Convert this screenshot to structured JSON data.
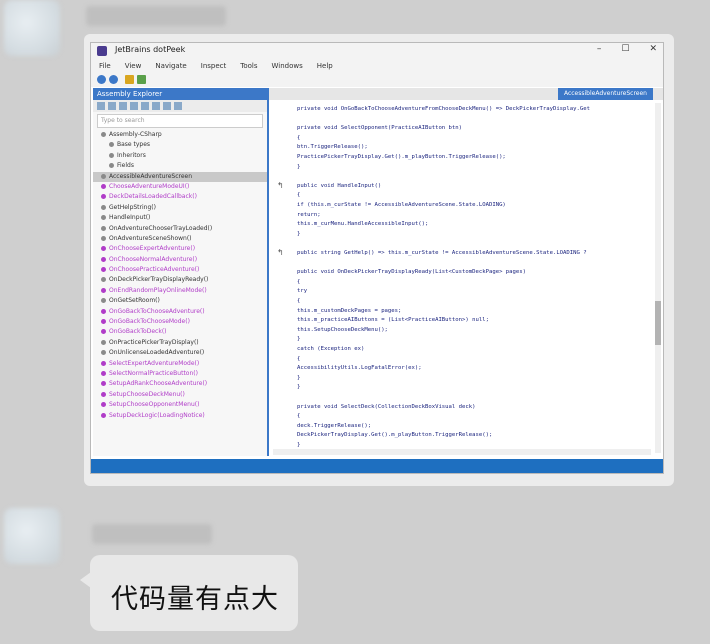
{
  "messages": [
    {
      "type": "image",
      "screenshot": {
        "window_title": "JetBrains dotPeek",
        "menu": [
          "File",
          "View",
          "Navigate",
          "Inspect",
          "Tools",
          "Windows",
          "Help"
        ],
        "explorer_title": "Assembly Explorer",
        "search_placeholder": "Type to search",
        "tree_items": [
          {
            "label": "Assembly-CSharp",
            "color": "#333333"
          },
          {
            "label": "Base types",
            "color": "#333333"
          },
          {
            "label": "Inheritors",
            "color": "#333333"
          },
          {
            "label": "Fields",
            "color": "#333333"
          },
          {
            "label": "AccessibleAdventureScreen",
            "color": "#333333",
            "selected": true
          },
          {
            "label": "ChooseAdventureModeUI()",
            "color": "#b03cc8"
          },
          {
            "label": "DeckDetailsLoadedCallback()",
            "color": "#b03cc8"
          },
          {
            "label": "GetHelpString()",
            "color": "#333333"
          },
          {
            "label": "HandleInput()",
            "color": "#333333"
          },
          {
            "label": "OnAdventureChooserTrayLoaded()",
            "color": "#333333"
          },
          {
            "label": "OnAdventureSceneShown()",
            "color": "#333333"
          },
          {
            "label": "OnChooseExpertAdventure()",
            "color": "#b03cc8"
          },
          {
            "label": "OnChooseNormalAdventure()",
            "color": "#b03cc8"
          },
          {
            "label": "OnChoosePracticeAdventure()",
            "color": "#b03cc8"
          },
          {
            "label": "OnDeckPickerTrayDisplayReady()",
            "color": "#333333"
          },
          {
            "label": "OnEndRandomPlayOnlineMode()",
            "color": "#b03cc8"
          },
          {
            "label": "OnGetSetRoom()",
            "color": "#333333"
          },
          {
            "label": "OnGoBackToChooseAdventure()",
            "color": "#b03cc8"
          },
          {
            "label": "OnGoBackToChooseMode()",
            "color": "#b03cc8"
          },
          {
            "label": "OnGoBackToDeck()",
            "color": "#b03cc8"
          },
          {
            "label": "OnPracticePickerTrayDisplay()",
            "color": "#333333"
          },
          {
            "label": "OnUnlicenseLoadedAdventure()",
            "color": "#333333"
          },
          {
            "label": "SelectExpertAdventureMode()",
            "color": "#b03cc8"
          },
          {
            "label": "SelectNormalPracticeButton()",
            "color": "#b03cc8"
          },
          {
            "label": "SetupAdRankChooseAdventure()",
            "color": "#b03cc8"
          },
          {
            "label": "SetupChooseDeckMenu()",
            "color": "#b03cc8"
          },
          {
            "label": "SetupChooseOpponentMenu()",
            "color": "#b03cc8"
          },
          {
            "label": "SetupDeckLogic(LoadingNotice)",
            "color": "#b03cc8"
          }
        ],
        "editor_tab": "AccessibleAdventureScreen",
        "code_lines": [
          "private void OnGoBackToChooseAdventureFromChooseDeckMenu() => DeckPickerTrayDisplay.Get",
          "",
          "private void SelectOpponent(PracticeAIButton btn)",
          "{",
          "  btn.TriggerRelease();",
          "  PracticePickerTrayDisplay.Get().m_playButton.TriggerRelease();",
          "}",
          "",
          "public void HandleInput()",
          "{",
          "  if (this.m_curState != AccessibleAdventureScene.State.LOADING)",
          "    return;",
          "  this.m_curMenu.HandleAccessibleInput();",
          "}",
          "",
          "public string GetHelp() => this.m_curState != AccessibleAdventureScene.State.LOADING ?",
          "",
          "public void OnDeckPickerTrayDisplayReady(List<CustomDeckPage> pages)",
          "{",
          "  try",
          "  {",
          "    this.m_customDeckPages = pages;",
          "    this.m_practiceAIButtons = (List<PracticeAIButton>) null;",
          "    this.SetupChooseDeckMenu();",
          "  }",
          "  catch (Exception ex)",
          "  {",
          "    AccessibilityUtils.LogFatalError(ex);",
          "  }",
          "}",
          "",
          "private void SelectDeck(CollectionDeckBoxVisual deck)",
          "{",
          "  deck.TriggerRelease();",
          "  DeckPickerTrayDisplay.Get().m_playButton.TriggerRelease();",
          "}"
        ]
      }
    },
    {
      "type": "text",
      "text": "代码量有点大"
    }
  ],
  "colors": {
    "accent": "#3c78c8",
    "status_bar": "#1e6fc0",
    "method_purple": "#b03cc8",
    "code_blue": "#1a237e"
  }
}
